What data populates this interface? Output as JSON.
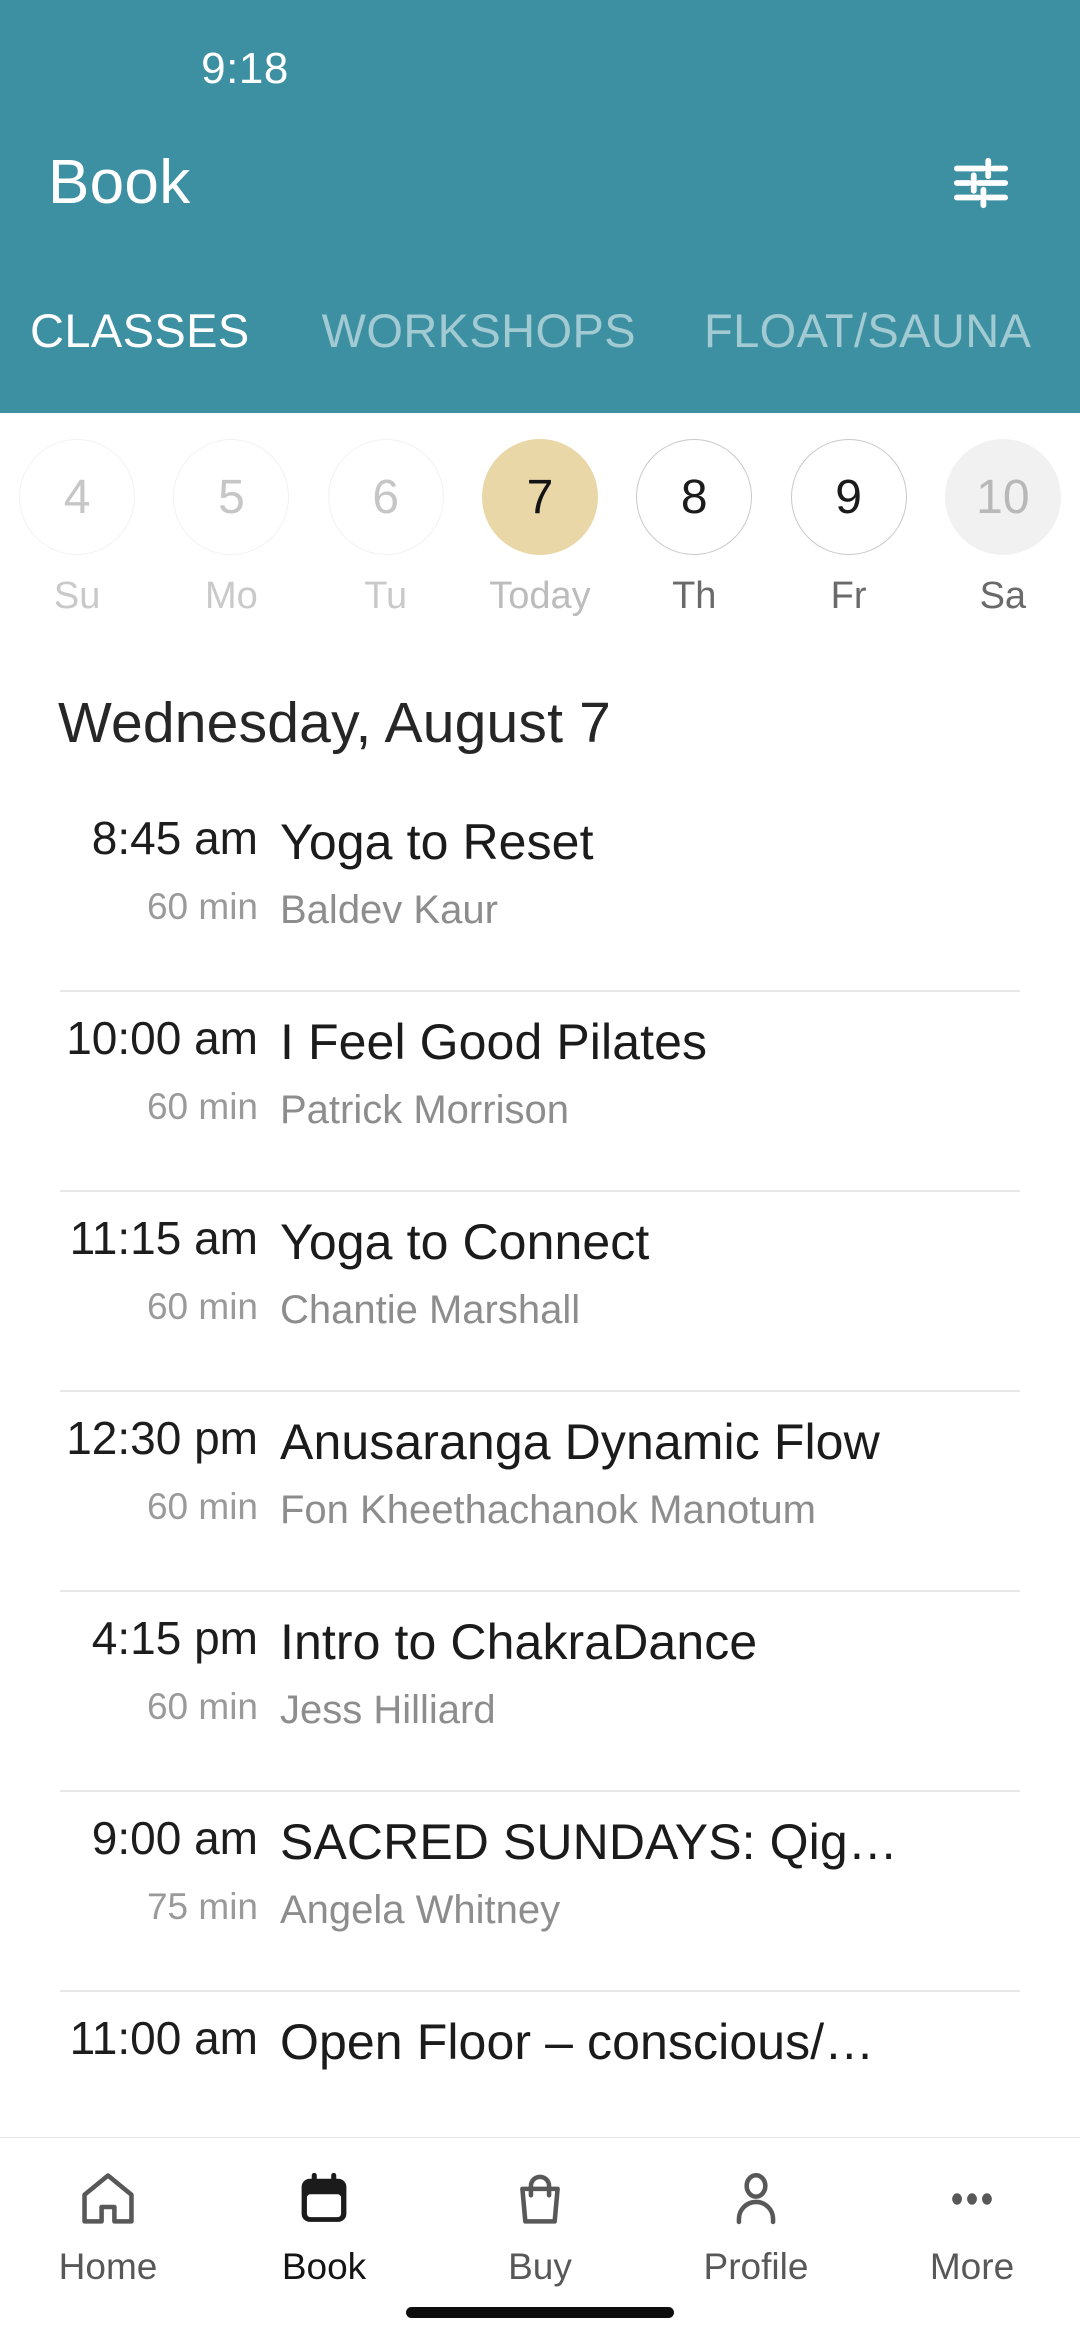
{
  "statusbar": {
    "time": "9:18"
  },
  "header": {
    "title": "Book",
    "filter_icon": "tune-sliders-icon",
    "bg_color": "#3d90a2",
    "tabs": [
      {
        "label": "CLASSES",
        "active": true
      },
      {
        "label": "WORKSHOPS",
        "active": false
      },
      {
        "label": "FLOAT/SAUNA",
        "active": false
      }
    ]
  },
  "date_strip": {
    "days": [
      {
        "num": "4",
        "label": "Su",
        "state": "past"
      },
      {
        "num": "5",
        "label": "Mo",
        "state": "past"
      },
      {
        "num": "6",
        "label": "Tu",
        "state": "past"
      },
      {
        "num": "7",
        "label": "Today",
        "state": "today"
      },
      {
        "num": "8",
        "label": "Th",
        "state": "future"
      },
      {
        "num": "9",
        "label": "Fr",
        "state": "future"
      },
      {
        "num": "10",
        "label": "Sa",
        "state": "dim"
      }
    ],
    "today_color": "#e9d7a7"
  },
  "schedule": {
    "date_heading": "Wednesday, August 7",
    "classes": [
      {
        "time": "8:45 am",
        "duration": "60 min",
        "name": "Yoga to Reset",
        "teacher": "Baldev Kaur"
      },
      {
        "time": "10:00 am",
        "duration": "60 min",
        "name": "I Feel Good Pilates",
        "teacher": "Patrick Morrison"
      },
      {
        "time": "11:15 am",
        "duration": "60 min",
        "name": "Yoga to Connect",
        "teacher": "Chantie Marshall"
      },
      {
        "time": "12:30 pm",
        "duration": "60 min",
        "name": "Anusaranga Dynamic Flow",
        "teacher": "Fon Kheethachanok Manotum"
      },
      {
        "time": "4:15 pm",
        "duration": "60 min",
        "name": "Intro to ChakraDance",
        "teacher": "Jess Hilliard"
      },
      {
        "time": "9:00 am",
        "duration": "75 min",
        "name": "SACRED SUNDAYS: Qig…",
        "teacher": "Angela Whitney"
      },
      {
        "time": "11:00 am",
        "duration": "",
        "name": "Open Floor – conscious/…",
        "teacher": ""
      }
    ]
  },
  "bottom_nav": {
    "items": [
      {
        "label": "Home",
        "icon": "house-icon",
        "active": false
      },
      {
        "label": "Book",
        "icon": "calendar-icon",
        "active": true
      },
      {
        "label": "Buy",
        "icon": "shopping-bag-icon",
        "active": false
      },
      {
        "label": "Profile",
        "icon": "person-icon",
        "active": false
      },
      {
        "label": "More",
        "icon": "ellipsis-icon",
        "active": false
      }
    ]
  }
}
